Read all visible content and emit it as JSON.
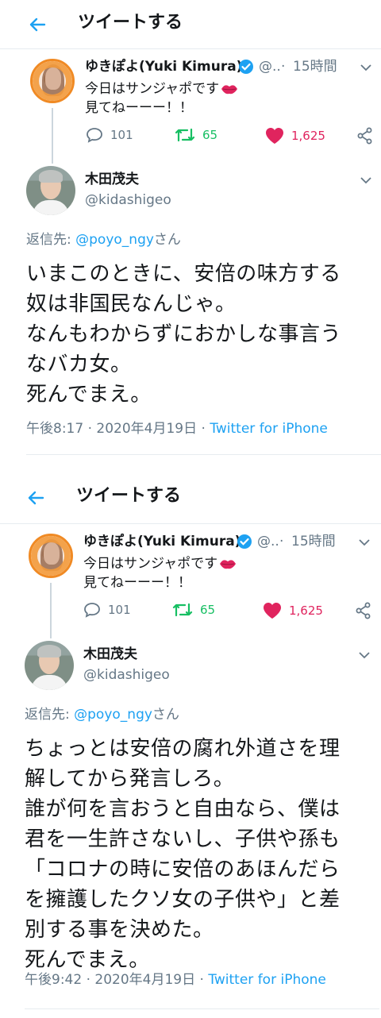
{
  "colors": {
    "accent": "#1da1f2",
    "text": "#14171a",
    "muted": "#657786",
    "retweet": "#17bf63",
    "like": "#e0245e",
    "divider": "#e6ecf0",
    "avatar_ring": "#f08a24"
  },
  "screens": [
    {
      "header": {
        "title": "ツイートする",
        "back_icon": "arrow-left-icon"
      },
      "parent": {
        "name": "ゆきぽよ(Yuki Kimura)",
        "verified_icon": "verified-badge-icon",
        "handle_truncated": "@..",
        "time_ago": "15時間",
        "text_line1": "今日はサンジャポです",
        "emoji_icon": "kiss-lips-icon",
        "text_line2": "見てねーーー！！",
        "replies": "101",
        "retweets": "65",
        "likes": "1,625"
      },
      "reply": {
        "name": "木田茂夫",
        "handle": "@kidashigeo",
        "reply_prefix": "返信先: ",
        "reply_mention": "@poyo_ngy",
        "reply_suffix": "さん",
        "text": "いまこのときに、安倍の味方する\n奴は非国民なんじゃ。\nなんもわからずにおかしな事言う\nなバカ女。\n死んでまえ。",
        "timestamp": "午後8:17 · 2020年4月19日 · ",
        "client": "Twitter for iPhone"
      }
    },
    {
      "header": {
        "title": "ツイートする",
        "back_icon": "arrow-left-icon"
      },
      "parent": {
        "name": "ゆきぽよ(Yuki Kimura)",
        "verified_icon": "verified-badge-icon",
        "handle_truncated": "@..",
        "time_ago": "15時間",
        "text_line1": "今日はサンジャポです",
        "emoji_icon": "kiss-lips-icon",
        "text_line2": "見てねーーー！！",
        "replies": "101",
        "retweets": "65",
        "likes": "1,625"
      },
      "reply": {
        "name": "木田茂夫",
        "handle": "@kidashigeo",
        "reply_prefix": "返信先: ",
        "reply_mention": "@poyo_ngy",
        "reply_suffix": "さん",
        "text": "ちょっとは安倍の腐れ外道さを理\n解してから発言しろ。\n誰が何を言おうと自由なら、僕は\n君を一生許さないし、子供や孫も\n「コロナの時に安倍のあほんだら\nを擁護したクソ女の子供や」と差\n別する事を決めた。\n死んでまえ。",
        "timestamp": "午後9:42 · 2020年4月19日 · ",
        "client": "Twitter for iPhone"
      }
    }
  ]
}
